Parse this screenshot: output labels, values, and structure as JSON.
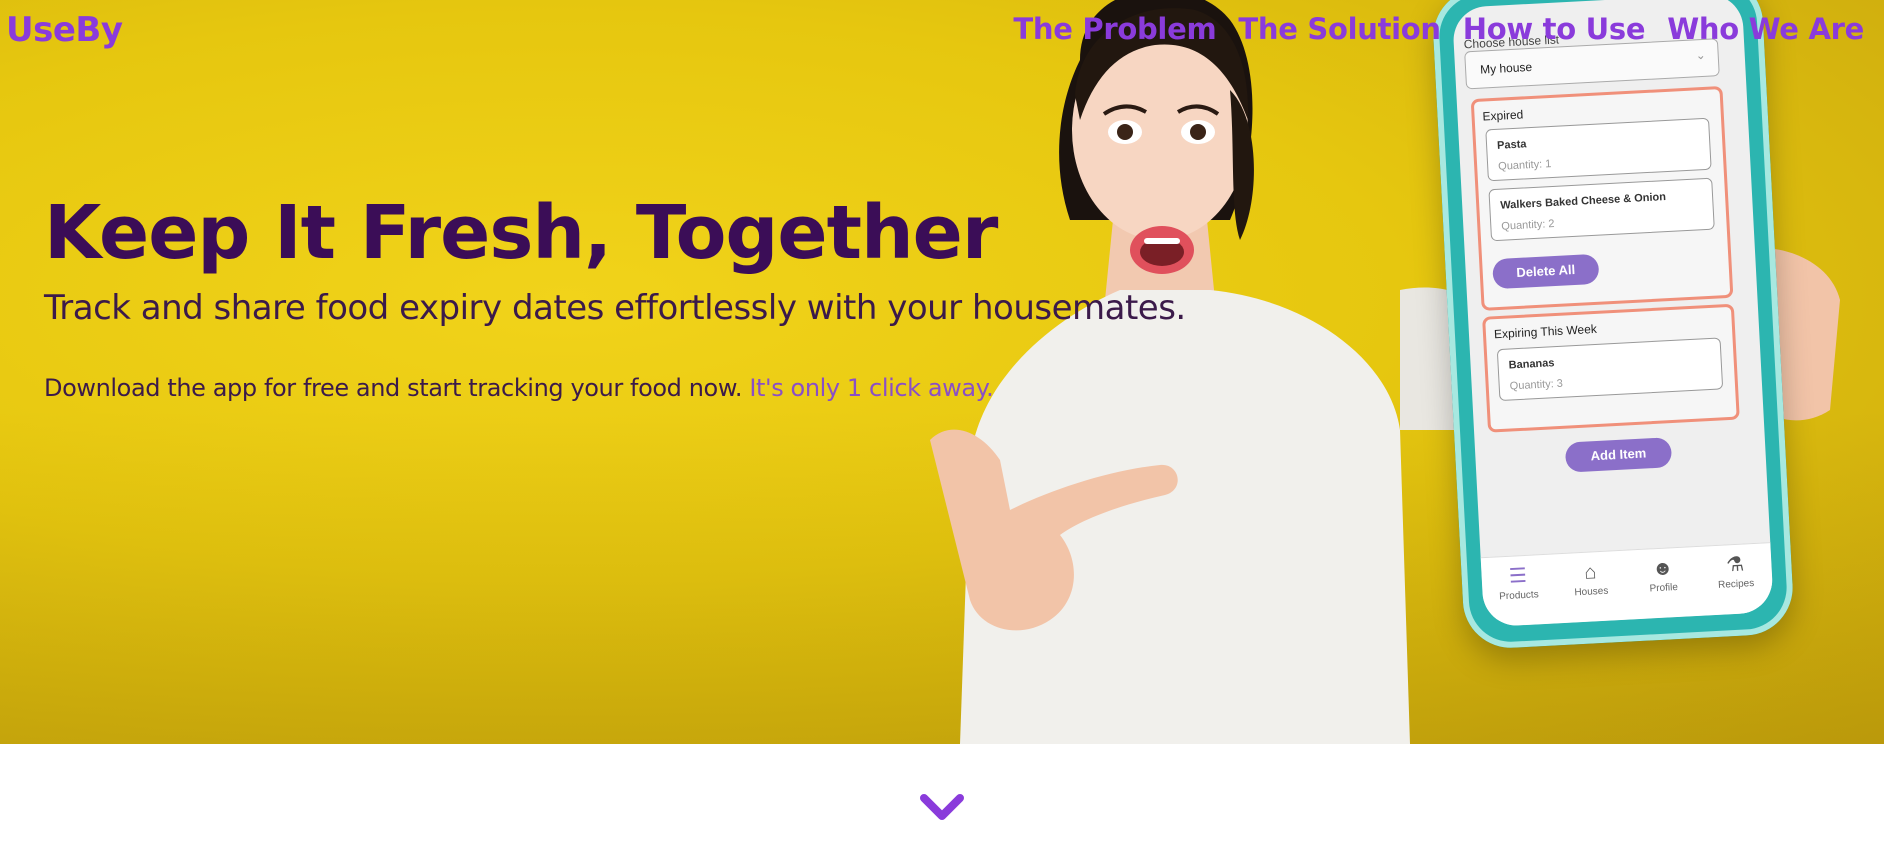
{
  "header": {
    "brand": "UseBy",
    "nav": [
      "The Problem",
      "The Solution",
      "How to Use",
      "Who We Are"
    ]
  },
  "hero": {
    "headline": "Keep It Fresh, Together",
    "subhead": "Track and share food expiry dates effortlessly with your housemates.",
    "cta_text": "Download the app for free and start tracking your food now.",
    "cta_link": "It's only 1 click away."
  },
  "phone": {
    "house_label": "Choose house list",
    "house_value": "My house",
    "expired_title": "Expired",
    "expired_items": [
      {
        "name": "Pasta",
        "quantity": "Quantity: 1"
      },
      {
        "name": "Walkers Baked Cheese & Onion",
        "quantity": "Quantity: 2"
      }
    ],
    "delete_all": "Delete All",
    "week_title": "Expiring This Week",
    "week_items": [
      {
        "name": "Bananas",
        "quantity": "Quantity: 3"
      }
    ],
    "add_item": "Add Item",
    "tabs": [
      "Products",
      "Houses",
      "Profile",
      "Recipes"
    ]
  },
  "colors": {
    "brand_purple": "#8a3bdb",
    "headline": "#3b0d57",
    "hero_yellow": "#e6c70f",
    "app_purple": "#8b6fc9",
    "section_border": "#f0907a"
  },
  "icons": {
    "scroll": "chevron-down-icon",
    "tabs": [
      "list-icon",
      "home-icon",
      "person-icon",
      "fork-knife-icon"
    ]
  }
}
